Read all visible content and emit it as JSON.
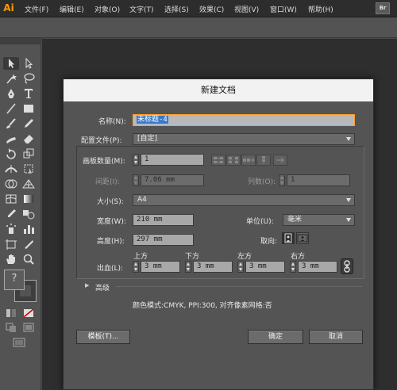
{
  "app": {
    "logo": "Ai"
  },
  "menu": {
    "items": [
      "文件(F)",
      "编辑(E)",
      "对象(O)",
      "文字(T)",
      "选择(S)",
      "效果(C)",
      "视图(V)",
      "窗口(W)",
      "帮助(H)"
    ],
    "bridge_badge": "Br"
  },
  "tools": {
    "icons": [
      "selection-tool-icon",
      "direct-selection-tool-icon",
      "magic-wand-tool-icon",
      "lasso-tool-icon",
      "pen-tool-icon",
      "type-tool-icon",
      "line-tool-icon",
      "rectangle-tool-icon",
      "paintbrush-tool-icon",
      "pencil-tool-icon",
      "blob-brush-tool-icon",
      "eraser-tool-icon",
      "rotate-tool-icon",
      "scale-tool-icon",
      "width-tool-icon",
      "free-transform-tool-icon",
      "shape-builder-tool-icon",
      "perspective-grid-tool-icon",
      "mesh-tool-icon",
      "gradient-tool-icon",
      "eyedropper-tool-icon",
      "blend-tool-icon",
      "symbol-sprayer-tool-icon",
      "column-graph-tool-icon",
      "artboard-tool-icon",
      "slice-tool-icon",
      "hand-tool-icon",
      "zoom-tool-icon"
    ],
    "fill_indicator": "?"
  },
  "dialog": {
    "title": "新建文档",
    "name_label": "名称(N):",
    "name_value": "未标题-4",
    "profile_label": "配置文件(P):",
    "profile_value": "[自定]",
    "artboards_label": "画板数量(M):",
    "artboards_value": "1",
    "spacing_label": "间距(I):",
    "spacing_value": "7.06 mm",
    "columns_label": "列数(O):",
    "columns_value": "1",
    "size_label": "大小(S):",
    "size_value": "A4",
    "width_label": "宽度(W):",
    "width_value": "210 mm",
    "units_label": "单位(U):",
    "units_value": "毫米",
    "height_label": "高度(H):",
    "height_value": "297 mm",
    "orientation_label": "取向:",
    "bleed_label": "出血(L):",
    "bleed_top_label": "上方",
    "bleed_top_value": "3 mm",
    "bleed_bottom_label": "下方",
    "bleed_bottom_value": "3 mm",
    "bleed_left_label": "左方",
    "bleed_left_value": "3 mm",
    "bleed_right_label": "右方",
    "bleed_right_value": "3 mm",
    "advanced_label": "高级",
    "info_text": "颜色模式:CMYK, PPI:300, 对齐像素网格:否",
    "templates_button": "模板(T)...",
    "ok_button": "确定",
    "cancel_button": "取消"
  },
  "colors": {
    "accent_focus": "#ffa12b",
    "selection_highlight": "#3a78c8",
    "logo": "#ff9a00"
  }
}
